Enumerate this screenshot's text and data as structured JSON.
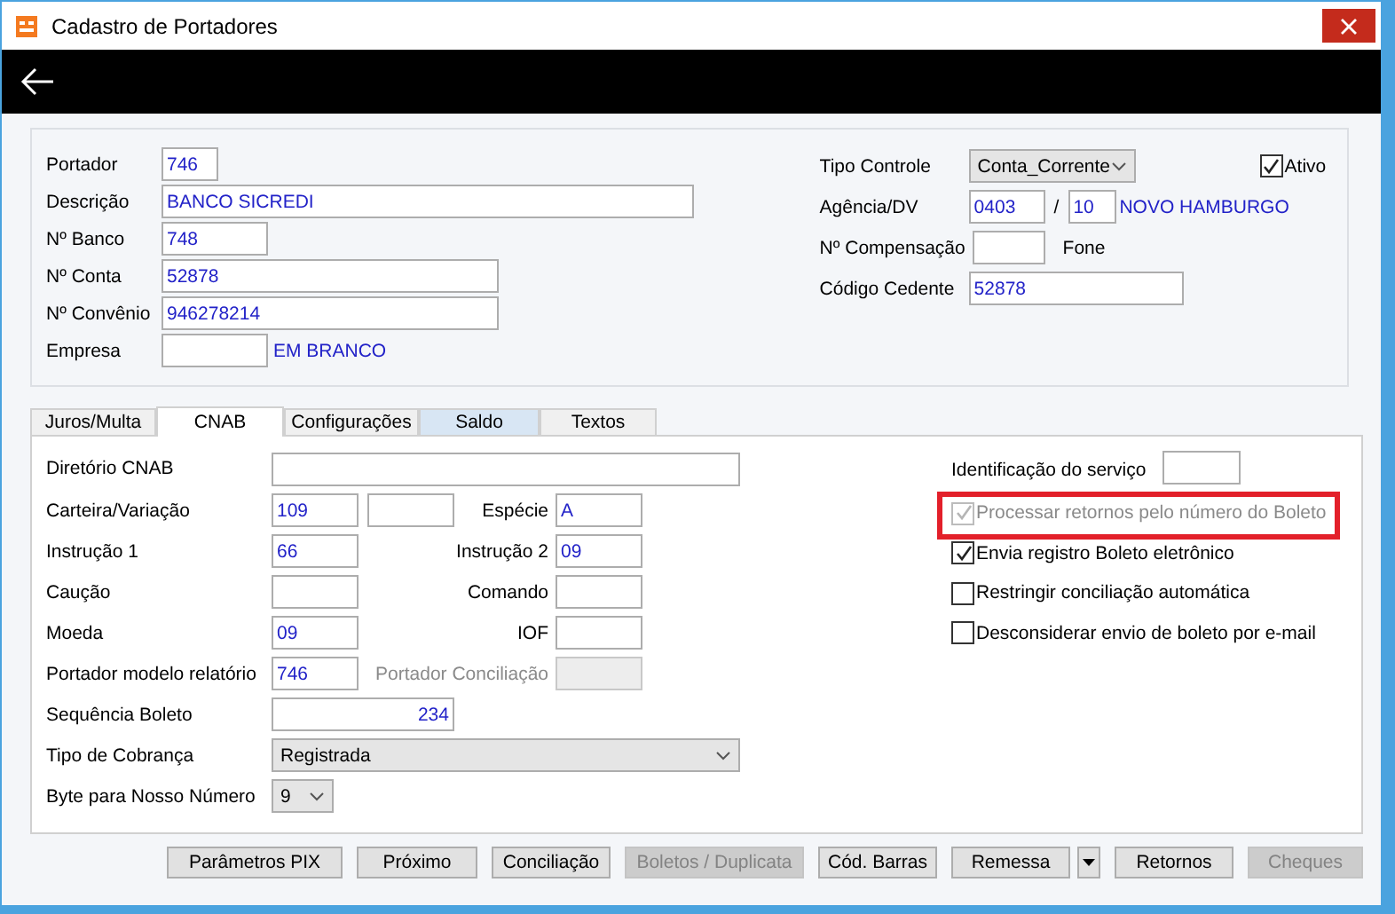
{
  "window": {
    "title": "Cadastro de Portadores"
  },
  "header": {
    "left": [
      {
        "label": "Portador",
        "value": "746"
      },
      {
        "label": "Descrição",
        "value": "BANCO SICREDI"
      },
      {
        "label": "Nº Banco",
        "value": "748"
      },
      {
        "label": "Nº Conta",
        "value": "52878"
      },
      {
        "label": "Nº Convênio",
        "value": "946278214"
      },
      {
        "label": "Empresa",
        "note": "EM BRANCO"
      }
    ],
    "tipo_controle": {
      "label": "Tipo Controle",
      "value": "Conta_Corrente"
    },
    "ativo": {
      "label": "Ativo",
      "checked": true
    },
    "agencia": {
      "label": "Agência/DV",
      "value": "0403",
      "separator": "/",
      "dv": "10",
      "note": "NOVO HAMBURGO"
    },
    "compensacao": {
      "label": "Nº Compensação",
      "note": "Fone"
    },
    "cedente": {
      "label": "Código Cedente",
      "value": "52878"
    }
  },
  "tabs": [
    {
      "label": "Juros/Multa",
      "selected": false,
      "hovered": false
    },
    {
      "label": "CNAB",
      "selected": true,
      "hovered": false
    },
    {
      "label": "Configurações",
      "selected": false,
      "hovered": false
    },
    {
      "label": "Saldo",
      "selected": false,
      "hovered": true
    },
    {
      "label": "Textos",
      "selected": false,
      "hovered": false
    }
  ],
  "cnab_rows": [
    {
      "kind": "wide",
      "label": "Diretório CNAB"
    },
    {
      "kind": "double",
      "label": "Carteira/Variação",
      "value": "109",
      "right": {
        "label": "Espécie",
        "value": "A",
        "disabled": false
      }
    },
    {
      "kind": "single",
      "label": "Instrução 1",
      "value": "66",
      "right": {
        "label": "Instrução 2",
        "value": "09",
        "disabled": false
      }
    },
    {
      "kind": "single",
      "label": "Caução",
      "right": {
        "label": "Comando",
        "disabled": false
      }
    },
    {
      "kind": "single",
      "label": "Moeda",
      "value": "09",
      "right": {
        "label": "IOF",
        "disabled": false
      }
    },
    {
      "kind": "single",
      "label": "Portador modelo relatório",
      "value": "746",
      "right": {
        "label": "Portador Conciliação",
        "disabled": true
      }
    },
    {
      "kind": "number",
      "label": "Sequência Boleto",
      "value": "234"
    },
    {
      "kind": "select-wide",
      "label": "Tipo de Cobrança",
      "value": "Registrada"
    },
    {
      "kind": "select-small",
      "label": "Byte para Nosso Número",
      "value": "9"
    }
  ],
  "identificacao": {
    "label": "Identificação do serviço"
  },
  "options": [
    {
      "label": "Processar retornos pelo número do Boleto",
      "checked": true,
      "disabled": true,
      "highlighted": true
    },
    {
      "label": "Envia registro Boleto eletrônico",
      "checked": true,
      "disabled": false,
      "highlighted": false
    },
    {
      "label": "Restringir conciliação automática",
      "checked": false,
      "disabled": false,
      "highlighted": false
    },
    {
      "label": "Desconsiderar envio de boleto por e-mail",
      "checked": false,
      "disabled": false,
      "highlighted": false
    }
  ],
  "buttons": [
    {
      "label": "Parâmetros PIX",
      "disabled": false,
      "has_menu": false
    },
    {
      "label": "Próximo",
      "disabled": false,
      "has_menu": false
    },
    {
      "label": "Conciliação",
      "disabled": false,
      "has_menu": false
    },
    {
      "label": "Boletos / Duplicata",
      "disabled": true,
      "has_menu": false
    },
    {
      "label": "Cód. Barras",
      "disabled": false,
      "has_menu": false
    },
    {
      "label": "Remessa",
      "disabled": false,
      "has_menu": true
    },
    {
      "label": "Retornos",
      "disabled": false,
      "has_menu": false
    },
    {
      "label": "Cheques",
      "disabled": true,
      "has_menu": false
    }
  ]
}
